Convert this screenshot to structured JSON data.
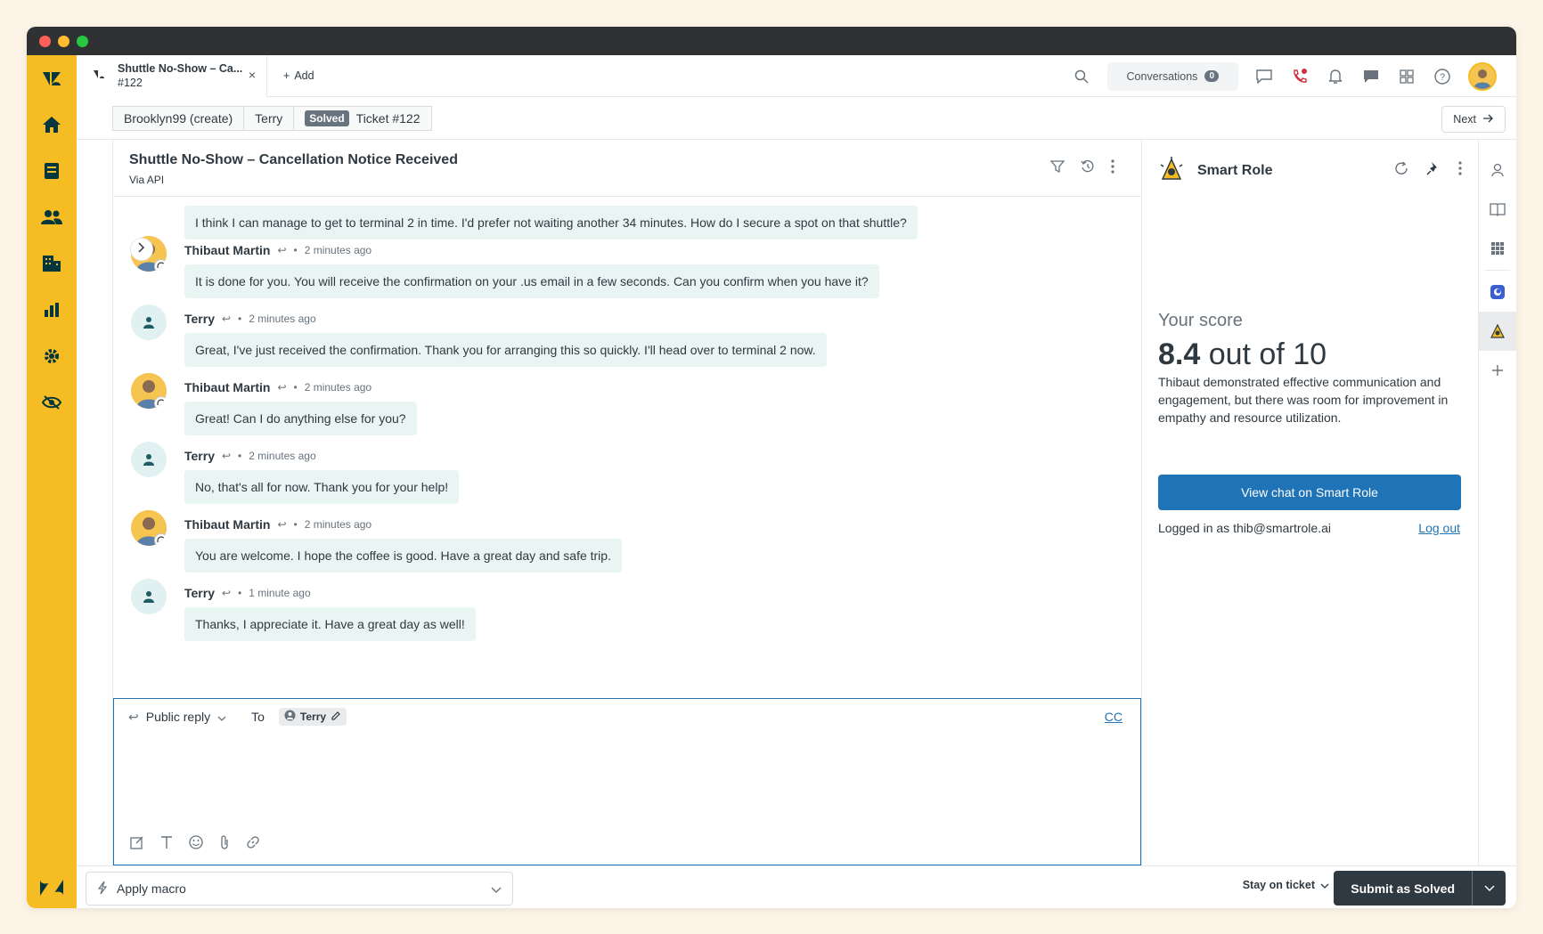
{
  "tab": {
    "title": "Shuttle No-Show – Ca...",
    "subtitle": "#122",
    "close": "×"
  },
  "add_tab": "Add",
  "topbar": {
    "conversations_label": "Conversations",
    "conversations_count": "0"
  },
  "breadcrumb": {
    "org": "Brooklyn99 (create)",
    "requester": "Terry",
    "status": "Solved",
    "ticket": "Ticket #122"
  },
  "next_label": "Next",
  "ticket": {
    "title": "Shuttle No-Show – Cancellation Notice Received",
    "via": "Via API"
  },
  "messages": [
    {
      "author": "",
      "time": "",
      "text": "I think I can manage to get to terminal 2 in time. I'd prefer not waiting another 34 minutes. How do I secure a spot on that shuttle?"
    },
    {
      "author": "Thibaut Martin",
      "time": "2 minutes ago",
      "text": "It is done for you. You will receive the confirmation on your .us email in a few seconds. Can you confirm when you have it?"
    },
    {
      "author": "Terry",
      "time": "2 minutes ago",
      "text": "Great, I've just received the confirmation. Thank you for arranging this so quickly. I'll head over to terminal 2 now."
    },
    {
      "author": "Thibaut Martin",
      "time": "2 minutes ago",
      "text": "Great! Can I do anything else for you?"
    },
    {
      "author": "Terry",
      "time": "2 minutes ago",
      "text": "No, that's all for now. Thank you for your help!"
    },
    {
      "author": "Thibaut Martin",
      "time": "2 minutes ago",
      "text": "You are welcome. I hope the coffee is good. Have a great day and safe trip."
    },
    {
      "author": "Terry",
      "time": "1 minute ago",
      "text": "Thanks, I appreciate it. Have a great day as well!"
    }
  ],
  "reply": {
    "mode": "Public reply",
    "to_label": "To",
    "to_name": "Terry",
    "cc": "CC"
  },
  "app": {
    "title": "Smart Role",
    "score_label": "Your score",
    "score_value": "8.4",
    "score_suffix": "out of 10",
    "description": "Thibaut demonstrated effective communication and engagement, but there was room for improvement in empathy and resource utilization.",
    "view_button": "View chat on Smart Role",
    "logged_in": "Logged in as thib@smartrole.ai",
    "logout": "Log out"
  },
  "bottom": {
    "macro": "Apply macro",
    "stay": "Stay on ticket",
    "submit": "Submit as Solved"
  },
  "colors": {
    "brand_yellow": "#f5bd23",
    "bubble": "#e9f5f3",
    "primary_blue": "#1f73b7",
    "dark": "#2f3941"
  }
}
